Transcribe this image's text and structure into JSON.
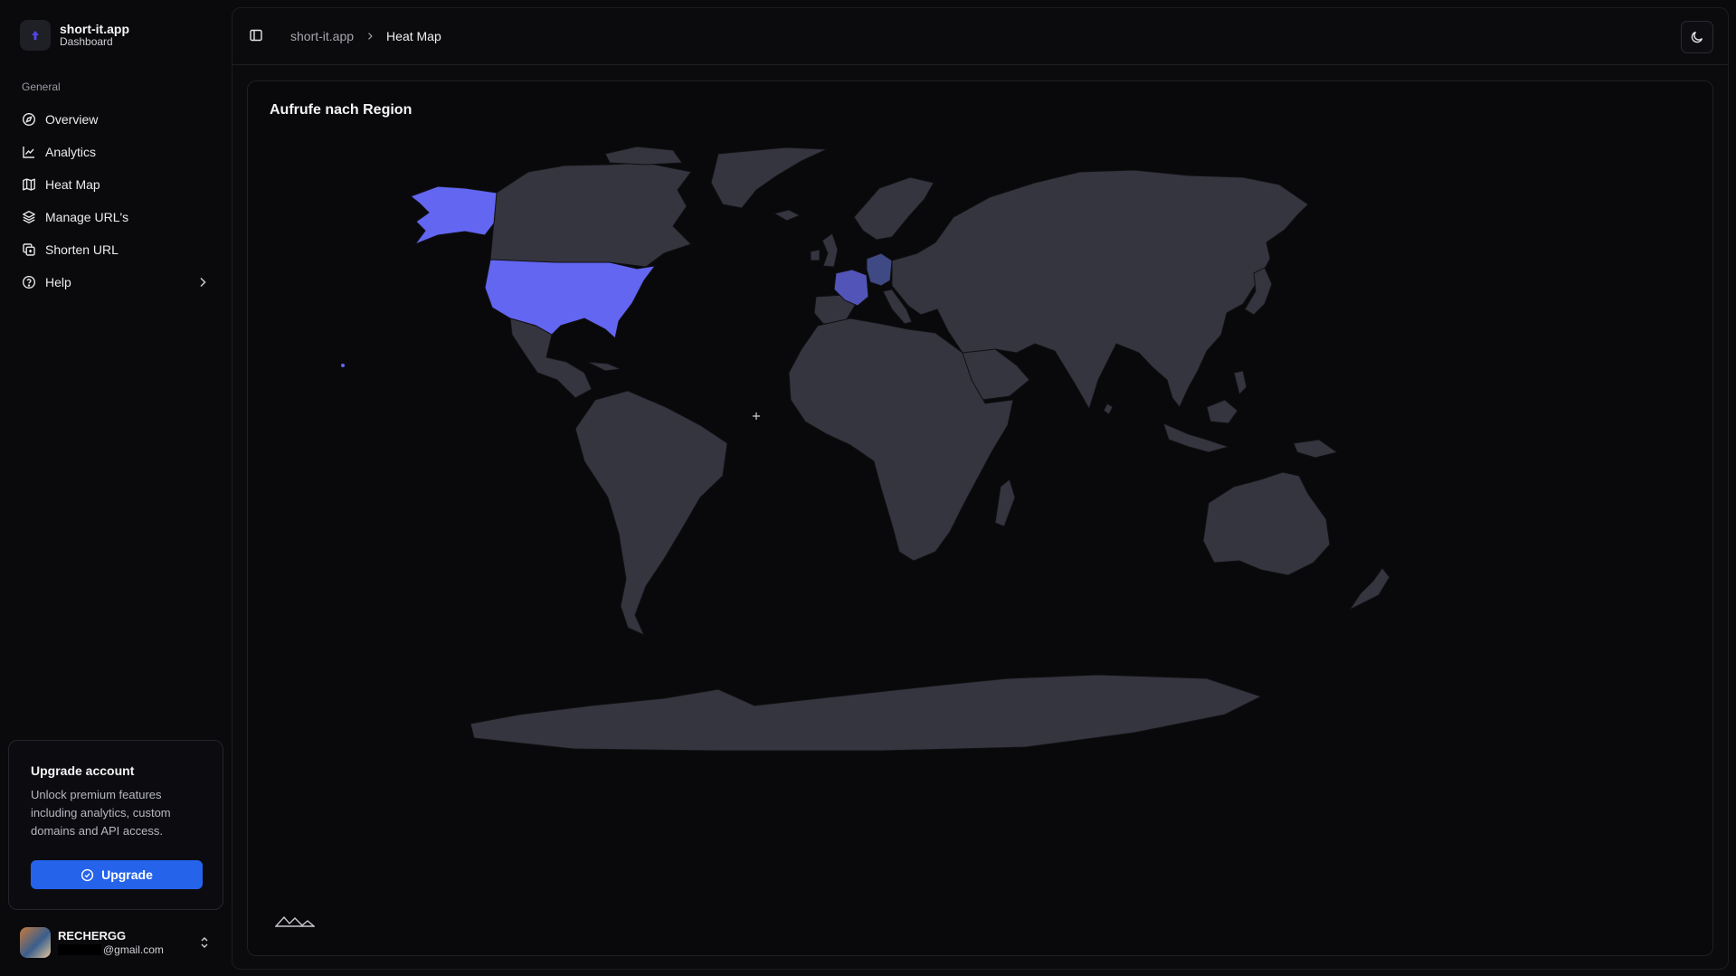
{
  "brand": {
    "name": "short-it.app",
    "subtitle": "Dashboard",
    "logo_icon": "arrow-up-icon"
  },
  "sidebar": {
    "section_label": "General",
    "items": [
      {
        "label": "Overview",
        "icon": "compass-icon"
      },
      {
        "label": "Analytics",
        "icon": "line-chart-icon"
      },
      {
        "label": "Heat Map",
        "icon": "map-icon"
      },
      {
        "label": "Manage URL's",
        "icon": "layers-icon"
      },
      {
        "label": "Shorten URL",
        "icon": "copy-icon"
      },
      {
        "label": "Help",
        "icon": "help-circle-icon",
        "has_submenu": true
      }
    ]
  },
  "upgrade": {
    "title": "Upgrade account",
    "description": "Unlock premium features including analytics, custom domains and API access.",
    "button_label": "Upgrade"
  },
  "user": {
    "name": "RECHERGG",
    "email_suffix": "@gmail.com"
  },
  "header": {
    "breadcrumb_root": "short-it.app",
    "breadcrumb_current": "Heat Map"
  },
  "heatmap": {
    "title": "Aufrufe nach Region",
    "base_color": "#35353f",
    "highlight_colors": {
      "high": "#6366f1",
      "medium": "#5254b8",
      "low": "#3f4a84"
    },
    "highlighted_regions": [
      {
        "region": "United States",
        "level": "high"
      },
      {
        "region": "France",
        "level": "medium"
      },
      {
        "region": "Germany",
        "level": "low"
      }
    ]
  },
  "colors": {
    "accent": "#2563eb",
    "background": "#0a0a0c"
  }
}
